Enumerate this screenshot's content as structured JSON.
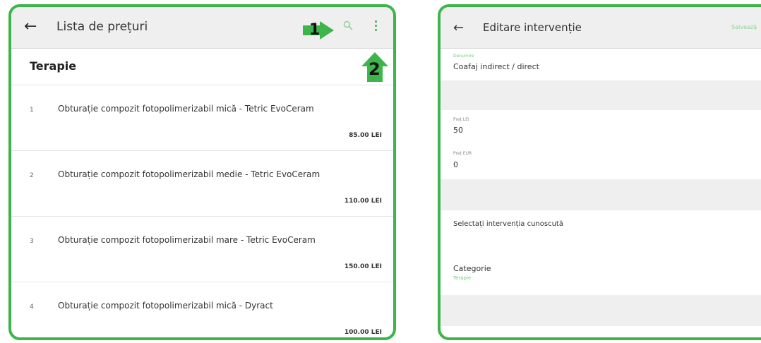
{
  "left_screen": {
    "title": "Lista de prețuri",
    "back_icon": "arrow-left-icon",
    "search_icon": "search-icon",
    "menu_icon": "more-vert-icon",
    "section": "Terapie",
    "items": [
      {
        "num": "1",
        "name": "Obturație compozit fotopolimerizabil mică - Tetric EvoCeram",
        "price": "85.00 LEI"
      },
      {
        "num": "2",
        "name": "Obturație compozit fotopolimerizabil medie - Tetric EvoCeram",
        "price": "110.00 LEI"
      },
      {
        "num": "3",
        "name": "Obturație compozit fotopolimerizabil mare - Tetric EvoCeram",
        "price": "150.00 LEI"
      },
      {
        "num": "4",
        "name": "Obturație compozit fotopolimerizabil mică - Dyract",
        "price": "100.00 LEI"
      }
    ]
  },
  "annotations": {
    "arrow1_label": "1",
    "arrow2_label": "2",
    "arrow_color": "#3db54a"
  },
  "right_screen": {
    "title": "Editare intervenție",
    "save_label": "Salvează",
    "fields": {
      "denumire_label": "Denumire",
      "denumire_value": "Coafaj indirect / direct",
      "pret_lei_label": "Preț LEI",
      "pret_lei_value": "50",
      "pret_eur_label": "Preț EUR",
      "pret_eur_value": "0"
    },
    "select_known": "Selectați intervenția cunoscută",
    "category_label": "Categorie",
    "category_value": "Terapie"
  },
  "colors": {
    "accent": "#3db54a",
    "appbar": "#efefef"
  }
}
